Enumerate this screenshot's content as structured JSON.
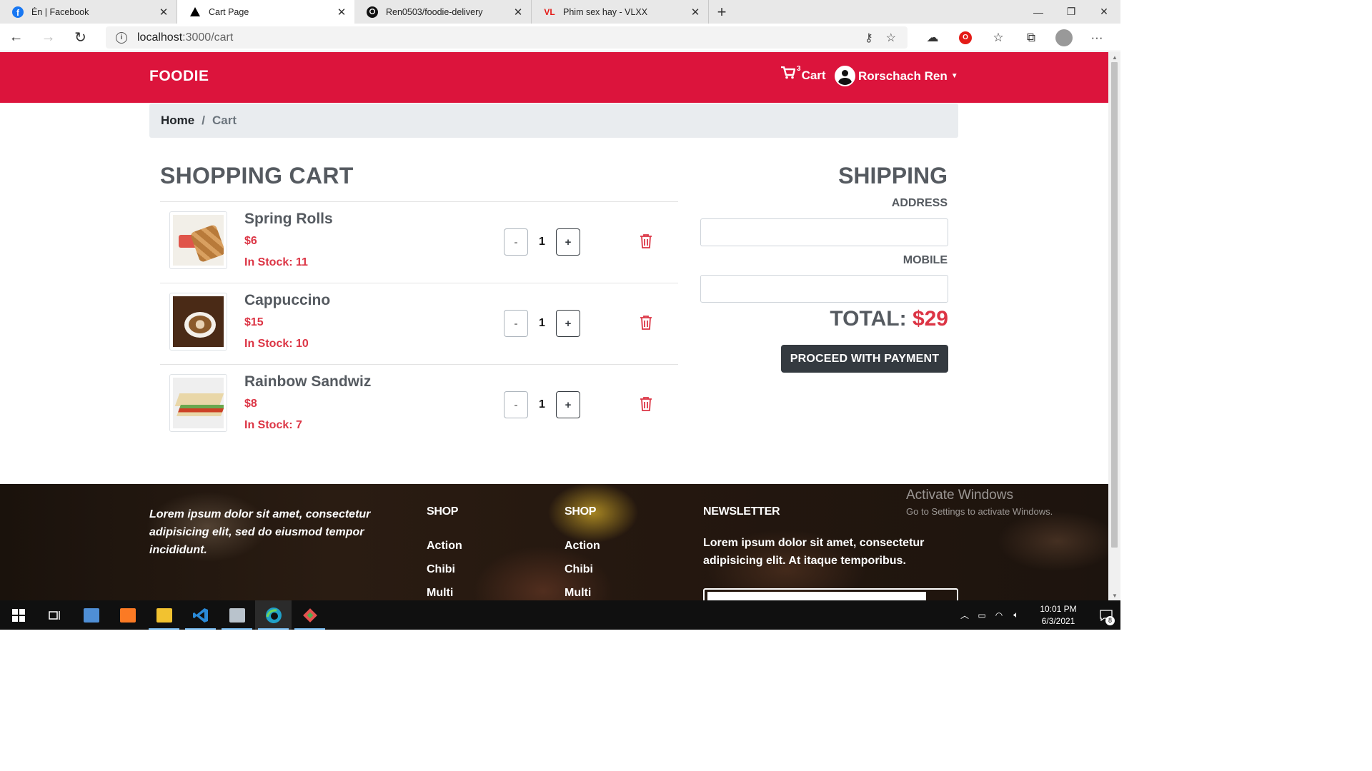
{
  "browser": {
    "tabs": [
      {
        "title": "Én | Facebook",
        "icon": "facebook-icon",
        "icon_color": "#1877f2"
      },
      {
        "title": "Cart Page",
        "icon": "triangle-app-icon",
        "icon_color": "#000000"
      },
      {
        "title": "Ren0503/foodie-delivery",
        "icon": "github-icon",
        "icon_color": "#000000"
      },
      {
        "title": "Phim sex hay - VLXX",
        "icon": "vl-icon",
        "icon_color": "#e41b17",
        "icon_text": "VL"
      }
    ],
    "url_host": "localhost",
    "url_path": ":3000/cart"
  },
  "site": {
    "brand": "FOODIE",
    "accent_color": "#dc143c",
    "cart_label": "Cart",
    "cart_count": "3",
    "user_name": "Rorschach Ren"
  },
  "breadcrumb": {
    "home": "Home",
    "separator": "/",
    "current": "Cart"
  },
  "cart": {
    "title": "SHOPPING CART",
    "items": [
      {
        "name": "Spring Rolls",
        "price": "$6",
        "stock": "In Stock: 11",
        "quantity": "1",
        "minus_label": "-",
        "plus_label": "+"
      },
      {
        "name": "Cappuccino",
        "price": "$15",
        "stock": "In Stock: 10",
        "quantity": "1",
        "minus_label": "-",
        "plus_label": "+"
      },
      {
        "name": "Rainbow Sandwiz",
        "price": "$8",
        "stock": "In Stock: 7",
        "quantity": "1",
        "minus_label": "-",
        "plus_label": "+"
      }
    ]
  },
  "shipping": {
    "title": "SHIPPING",
    "address_label": "ADDRESS",
    "address_value": "",
    "mobile_label": "MOBILE",
    "mobile_value": "",
    "total_label": "TOTAL:",
    "total_amount": "$29",
    "pay_button": "PROCEED WITH PAYMENT"
  },
  "footer": {
    "about": "Lorem ipsum dolor sit amet, consectetur adipisicing elit, sed do eiusmod tempor incididunt.",
    "columns": [
      {
        "title": "SHOP",
        "links": [
          "Action",
          "Chibi",
          "Multi"
        ]
      },
      {
        "title": "SHOP",
        "links": [
          "Action",
          "Chibi",
          "Multi"
        ]
      }
    ],
    "newsletter_title": "NEWSLETTER",
    "newsletter_text": "Lorem ipsum dolor sit amet, consectetur adipisicing elit. At itaque temporibus."
  },
  "watermark": {
    "line1": "Activate Windows",
    "line2": "Go to Settings to activate Windows."
  },
  "taskbar": {
    "time": "10:01 PM",
    "date": "6/3/2021",
    "notifications": "8"
  }
}
